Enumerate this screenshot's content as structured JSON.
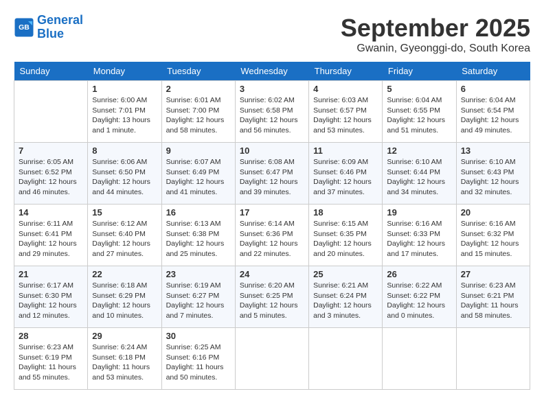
{
  "header": {
    "logo_line1": "General",
    "logo_line2": "Blue",
    "month": "September 2025",
    "location": "Gwanin, Gyeonggi-do, South Korea"
  },
  "weekdays": [
    "Sunday",
    "Monday",
    "Tuesday",
    "Wednesday",
    "Thursday",
    "Friday",
    "Saturday"
  ],
  "weeks": [
    [
      {
        "day": "",
        "info": ""
      },
      {
        "day": "1",
        "info": "Sunrise: 6:00 AM\nSunset: 7:01 PM\nDaylight: 13 hours\nand 1 minute."
      },
      {
        "day": "2",
        "info": "Sunrise: 6:01 AM\nSunset: 7:00 PM\nDaylight: 12 hours\nand 58 minutes."
      },
      {
        "day": "3",
        "info": "Sunrise: 6:02 AM\nSunset: 6:58 PM\nDaylight: 12 hours\nand 56 minutes."
      },
      {
        "day": "4",
        "info": "Sunrise: 6:03 AM\nSunset: 6:57 PM\nDaylight: 12 hours\nand 53 minutes."
      },
      {
        "day": "5",
        "info": "Sunrise: 6:04 AM\nSunset: 6:55 PM\nDaylight: 12 hours\nand 51 minutes."
      },
      {
        "day": "6",
        "info": "Sunrise: 6:04 AM\nSunset: 6:54 PM\nDaylight: 12 hours\nand 49 minutes."
      }
    ],
    [
      {
        "day": "7",
        "info": "Sunrise: 6:05 AM\nSunset: 6:52 PM\nDaylight: 12 hours\nand 46 minutes."
      },
      {
        "day": "8",
        "info": "Sunrise: 6:06 AM\nSunset: 6:50 PM\nDaylight: 12 hours\nand 44 minutes."
      },
      {
        "day": "9",
        "info": "Sunrise: 6:07 AM\nSunset: 6:49 PM\nDaylight: 12 hours\nand 41 minutes."
      },
      {
        "day": "10",
        "info": "Sunrise: 6:08 AM\nSunset: 6:47 PM\nDaylight: 12 hours\nand 39 minutes."
      },
      {
        "day": "11",
        "info": "Sunrise: 6:09 AM\nSunset: 6:46 PM\nDaylight: 12 hours\nand 37 minutes."
      },
      {
        "day": "12",
        "info": "Sunrise: 6:10 AM\nSunset: 6:44 PM\nDaylight: 12 hours\nand 34 minutes."
      },
      {
        "day": "13",
        "info": "Sunrise: 6:10 AM\nSunset: 6:43 PM\nDaylight: 12 hours\nand 32 minutes."
      }
    ],
    [
      {
        "day": "14",
        "info": "Sunrise: 6:11 AM\nSunset: 6:41 PM\nDaylight: 12 hours\nand 29 minutes."
      },
      {
        "day": "15",
        "info": "Sunrise: 6:12 AM\nSunset: 6:40 PM\nDaylight: 12 hours\nand 27 minutes."
      },
      {
        "day": "16",
        "info": "Sunrise: 6:13 AM\nSunset: 6:38 PM\nDaylight: 12 hours\nand 25 minutes."
      },
      {
        "day": "17",
        "info": "Sunrise: 6:14 AM\nSunset: 6:36 PM\nDaylight: 12 hours\nand 22 minutes."
      },
      {
        "day": "18",
        "info": "Sunrise: 6:15 AM\nSunset: 6:35 PM\nDaylight: 12 hours\nand 20 minutes."
      },
      {
        "day": "19",
        "info": "Sunrise: 6:16 AM\nSunset: 6:33 PM\nDaylight: 12 hours\nand 17 minutes."
      },
      {
        "day": "20",
        "info": "Sunrise: 6:16 AM\nSunset: 6:32 PM\nDaylight: 12 hours\nand 15 minutes."
      }
    ],
    [
      {
        "day": "21",
        "info": "Sunrise: 6:17 AM\nSunset: 6:30 PM\nDaylight: 12 hours\nand 12 minutes."
      },
      {
        "day": "22",
        "info": "Sunrise: 6:18 AM\nSunset: 6:29 PM\nDaylight: 12 hours\nand 10 minutes."
      },
      {
        "day": "23",
        "info": "Sunrise: 6:19 AM\nSunset: 6:27 PM\nDaylight: 12 hours\nand 7 minutes."
      },
      {
        "day": "24",
        "info": "Sunrise: 6:20 AM\nSunset: 6:25 PM\nDaylight: 12 hours\nand 5 minutes."
      },
      {
        "day": "25",
        "info": "Sunrise: 6:21 AM\nSunset: 6:24 PM\nDaylight: 12 hours\nand 3 minutes."
      },
      {
        "day": "26",
        "info": "Sunrise: 6:22 AM\nSunset: 6:22 PM\nDaylight: 12 hours\nand 0 minutes."
      },
      {
        "day": "27",
        "info": "Sunrise: 6:23 AM\nSunset: 6:21 PM\nDaylight: 11 hours\nand 58 minutes."
      }
    ],
    [
      {
        "day": "28",
        "info": "Sunrise: 6:23 AM\nSunset: 6:19 PM\nDaylight: 11 hours\nand 55 minutes."
      },
      {
        "day": "29",
        "info": "Sunrise: 6:24 AM\nSunset: 6:18 PM\nDaylight: 11 hours\nand 53 minutes."
      },
      {
        "day": "30",
        "info": "Sunrise: 6:25 AM\nSunset: 6:16 PM\nDaylight: 11 hours\nand 50 minutes."
      },
      {
        "day": "",
        "info": ""
      },
      {
        "day": "",
        "info": ""
      },
      {
        "day": "",
        "info": ""
      },
      {
        "day": "",
        "info": ""
      }
    ]
  ]
}
